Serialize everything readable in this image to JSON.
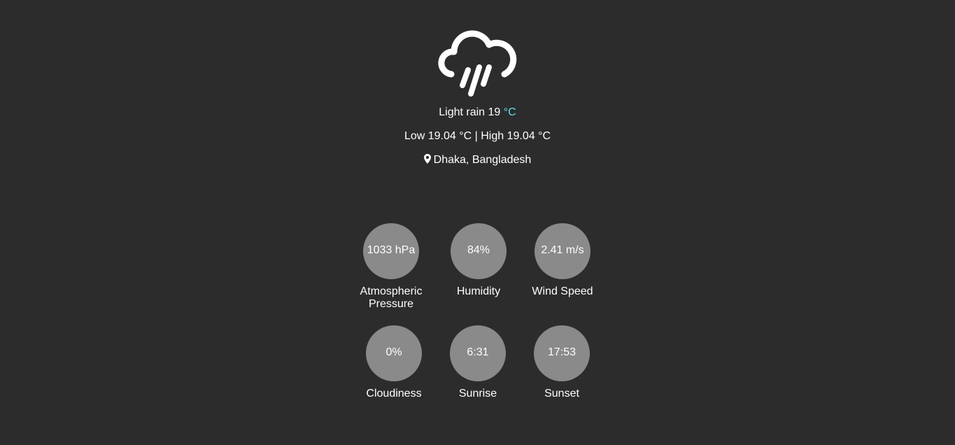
{
  "current": {
    "icon": "rain-cloud-icon",
    "description": "Light rain",
    "temperature": "19",
    "unit": "°C",
    "low_high": "Low 19.04 °C | High 19.04 °C",
    "location_icon": "map-pin-icon",
    "location": "Dhaka, Bangladesh"
  },
  "stats": {
    "pressure": {
      "value": "1033 hPa",
      "label": "Atmospheric Pressure"
    },
    "humidity": {
      "value": "84%",
      "label": "Humidity"
    },
    "wind_speed": {
      "value": "2.41 m/s",
      "label": "Wind Speed"
    },
    "cloudiness": {
      "value": "0%",
      "label": "Cloudiness"
    },
    "sunrise": {
      "value": "6:31",
      "label": "Sunrise"
    },
    "sunset": {
      "value": "17:53",
      "label": "Sunset"
    }
  },
  "colors": {
    "background": "#2c2c2c",
    "circle": "#8a8a8a",
    "accent": "#5fe0e6",
    "text": "#ffffff"
  }
}
